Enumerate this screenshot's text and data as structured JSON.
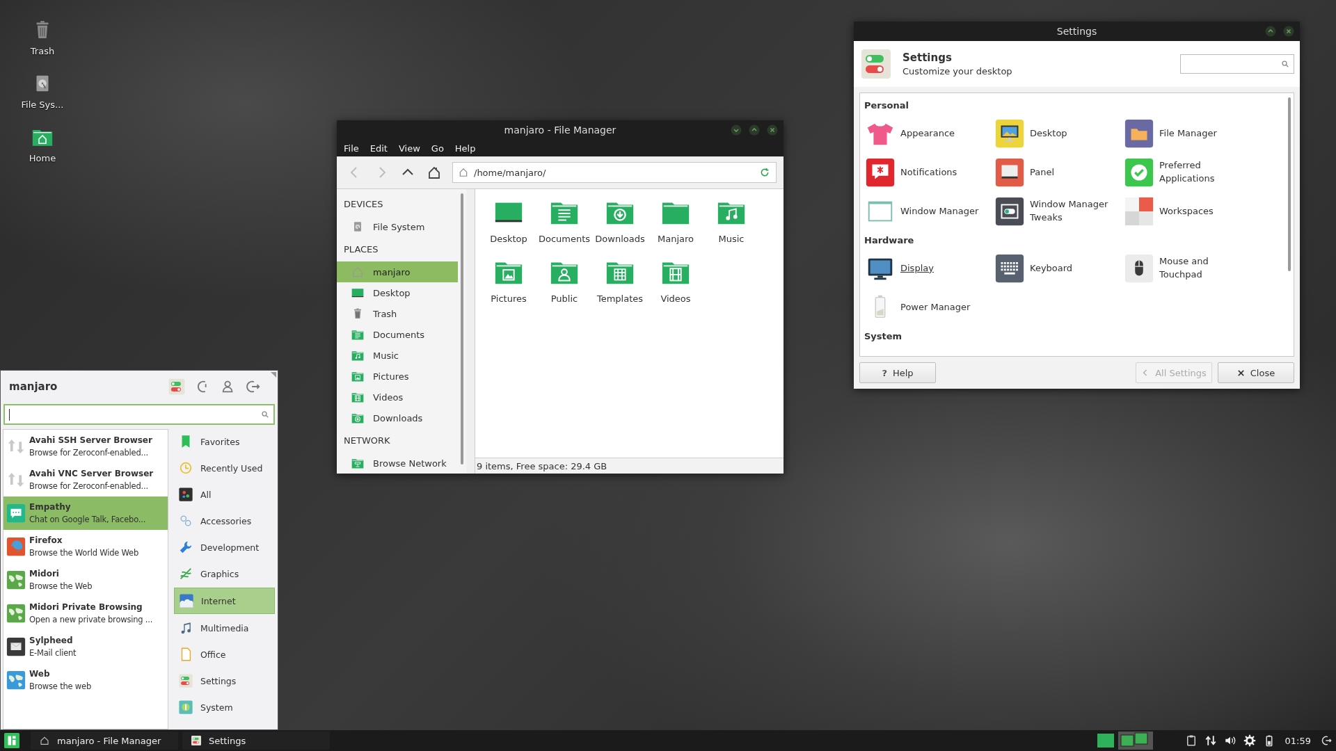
{
  "desktop_icons": [
    {
      "label": "Trash",
      "kind": "trash"
    },
    {
      "label": "File Sys...",
      "kind": "drive"
    },
    {
      "label": "Home",
      "kind": "home"
    }
  ],
  "file_manager": {
    "title": "manjaro - File Manager",
    "menu": [
      "File",
      "Edit",
      "View",
      "Go",
      "Help"
    ],
    "toolbar": [
      {
        "kind": "back",
        "disabled": true
      },
      {
        "kind": "forward",
        "disabled": true
      },
      {
        "kind": "up",
        "disabled": false
      },
      {
        "kind": "home",
        "disabled": false
      }
    ],
    "path": "/home/manjaro/",
    "sidebar": [
      {
        "heading": "DEVICES",
        "items": [
          {
            "label": "File System",
            "kind": "drive",
            "selected": false
          }
        ]
      },
      {
        "heading": "PLACES",
        "items": [
          {
            "label": "manjaro",
            "kind": "homeline",
            "selected": true
          },
          {
            "label": "Desktop",
            "kind": "screen",
            "selected": false
          },
          {
            "label": "Trash",
            "kind": "trash",
            "selected": false
          },
          {
            "label": "Documents",
            "kind": "doc",
            "selected": false
          },
          {
            "label": "Music",
            "kind": "music",
            "selected": false
          },
          {
            "label": "Pictures",
            "kind": "picture",
            "selected": false
          },
          {
            "label": "Videos",
            "kind": "videos",
            "selected": false
          },
          {
            "label": "Downloads",
            "kind": "download",
            "selected": false
          }
        ]
      },
      {
        "heading": "NETWORK",
        "items": [
          {
            "label": "Browse Network",
            "kind": "network",
            "selected": false
          }
        ]
      }
    ],
    "files": [
      {
        "label": "Desktop",
        "kind": "screen"
      },
      {
        "label": "Documents",
        "kind": "doc"
      },
      {
        "label": "Downloads",
        "kind": "download"
      },
      {
        "label": "Manjaro",
        "kind": "folder"
      },
      {
        "label": "Music",
        "kind": "music"
      },
      {
        "label": "Pictures",
        "kind": "picture"
      },
      {
        "label": "Public",
        "kind": "public"
      },
      {
        "label": "Templates",
        "kind": "templates"
      },
      {
        "label": "Videos",
        "kind": "videos"
      }
    ],
    "status_bar": "9 items, Free space: 29.4 GB"
  },
  "settings": {
    "title": "Settings",
    "heading": "Settings",
    "subtitle": "Customize your desktop",
    "sections": [
      {
        "heading": "Personal",
        "items": [
          {
            "label": "Appearance",
            "kind": "appearance",
            "hovered": false
          },
          {
            "label": "Desktop",
            "kind": "desktop",
            "hovered": false
          },
          {
            "label": "File Manager",
            "kind": "filemanager",
            "hovered": false
          },
          {
            "label": "Notifications",
            "kind": "notifications",
            "hovered": false
          },
          {
            "label": "Panel",
            "kind": "panel",
            "hovered": false
          },
          {
            "label": "Preferred Applications",
            "kind": "preferred",
            "hovered": false
          },
          {
            "label": "Window Manager",
            "kind": "wm",
            "hovered": false
          },
          {
            "label": "Window Manager Tweaks",
            "kind": "wmtweaks",
            "hovered": false
          },
          {
            "label": "Workspaces",
            "kind": "workspaces",
            "hovered": false
          }
        ]
      },
      {
        "heading": "Hardware",
        "items": [
          {
            "label": "Display",
            "kind": "display",
            "hovered": true
          },
          {
            "label": "Keyboard",
            "kind": "keyboard",
            "hovered": false
          },
          {
            "label": "Mouse and Touchpad",
            "kind": "mouse",
            "hovered": false
          },
          {
            "label": "Power Manager",
            "kind": "power",
            "hovered": false
          }
        ]
      },
      {
        "heading": "System"
      }
    ],
    "buttons": [
      {
        "label": "Help",
        "icon": "?",
        "kind": "help",
        "disabled": false
      },
      {
        "label": "All Settings",
        "kind": "back",
        "disabled": true
      },
      {
        "label": "Close",
        "kind": "close",
        "disabled": false
      }
    ]
  },
  "menu": {
    "user": "manjaro",
    "apps": [
      {
        "name": "Avahi SSH Server Browser",
        "description": "Browse for Zeroconf-enabled...",
        "kind": "avahi",
        "selected": false
      },
      {
        "name": "Avahi VNC Server Browser",
        "description": "Browse for Zeroconf-enabled...",
        "kind": "avahi",
        "selected": false
      },
      {
        "name": "Empathy",
        "description": "Chat on Google Talk, Facebo...",
        "kind": "empathy",
        "selected": true
      },
      {
        "name": "Firefox",
        "description": "Browse the World Wide Web",
        "kind": "firefox",
        "selected": false
      },
      {
        "name": "Midori",
        "description": "Browse the Web",
        "kind": "midori",
        "selected": false
      },
      {
        "name": "Midori Private Browsing",
        "description": "Open a new private browsing ...",
        "kind": "midori",
        "selected": false
      },
      {
        "name": "Sylpheed",
        "description": "E-Mail client",
        "kind": "sylpheed",
        "selected": false
      },
      {
        "name": "Web",
        "description": "Browse the web",
        "kind": "web",
        "selected": false
      }
    ],
    "categories": [
      {
        "label": "Favorites",
        "kind": "favorites",
        "selected": false
      },
      {
        "label": "Recently Used",
        "kind": "recent",
        "selected": false
      },
      {
        "label": "All",
        "kind": "all",
        "selected": false
      },
      {
        "label": "Accessories",
        "kind": "accessories",
        "selected": false
      },
      {
        "label": "Development",
        "kind": "development",
        "selected": false
      },
      {
        "label": "Graphics",
        "kind": "graphics",
        "selected": false
      },
      {
        "label": "Internet",
        "kind": "internet",
        "selected": true
      },
      {
        "label": "Multimedia",
        "kind": "multimedia",
        "selected": false
      },
      {
        "label": "Office",
        "kind": "office",
        "selected": false
      },
      {
        "label": "Settings",
        "kind": "toggles",
        "selected": false
      },
      {
        "label": "System",
        "kind": "system",
        "selected": false
      }
    ]
  },
  "taskbar": {
    "tasks": [
      {
        "label": "manjaro - File Manager",
        "kind": "files"
      },
      {
        "label": "Settings",
        "kind": "toggles"
      }
    ],
    "clock": "01:59"
  }
}
